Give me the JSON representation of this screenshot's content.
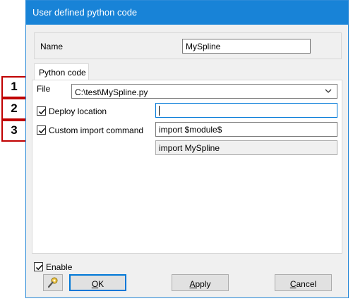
{
  "window": {
    "title": "User defined python code"
  },
  "name_field": {
    "label": "Name",
    "value": "MySpline"
  },
  "tabs": [
    {
      "label": "Python code"
    }
  ],
  "file": {
    "label": "File",
    "value": "C:\\test\\MySpline.py"
  },
  "deploy_location": {
    "label": "Deploy location",
    "checked": true,
    "value": ""
  },
  "custom_import": {
    "label": "Custom import command",
    "checked": true,
    "value": "import $module$",
    "preview": "import MySpline"
  },
  "enable": {
    "label": "Enable",
    "checked": true
  },
  "buttons": {
    "icon_button": "tool-icon",
    "ok": {
      "mnemonic": "O",
      "rest": "K"
    },
    "apply": {
      "mnemonic": "A",
      "rest": "pply"
    },
    "cancel": {
      "mnemonic": "C",
      "rest": "ancel"
    }
  },
  "callouts": [
    "1",
    "2",
    "3"
  ],
  "colors": {
    "titlebar": "#1883d7",
    "callout_border": "#c00000",
    "focus": "#0078d7"
  }
}
